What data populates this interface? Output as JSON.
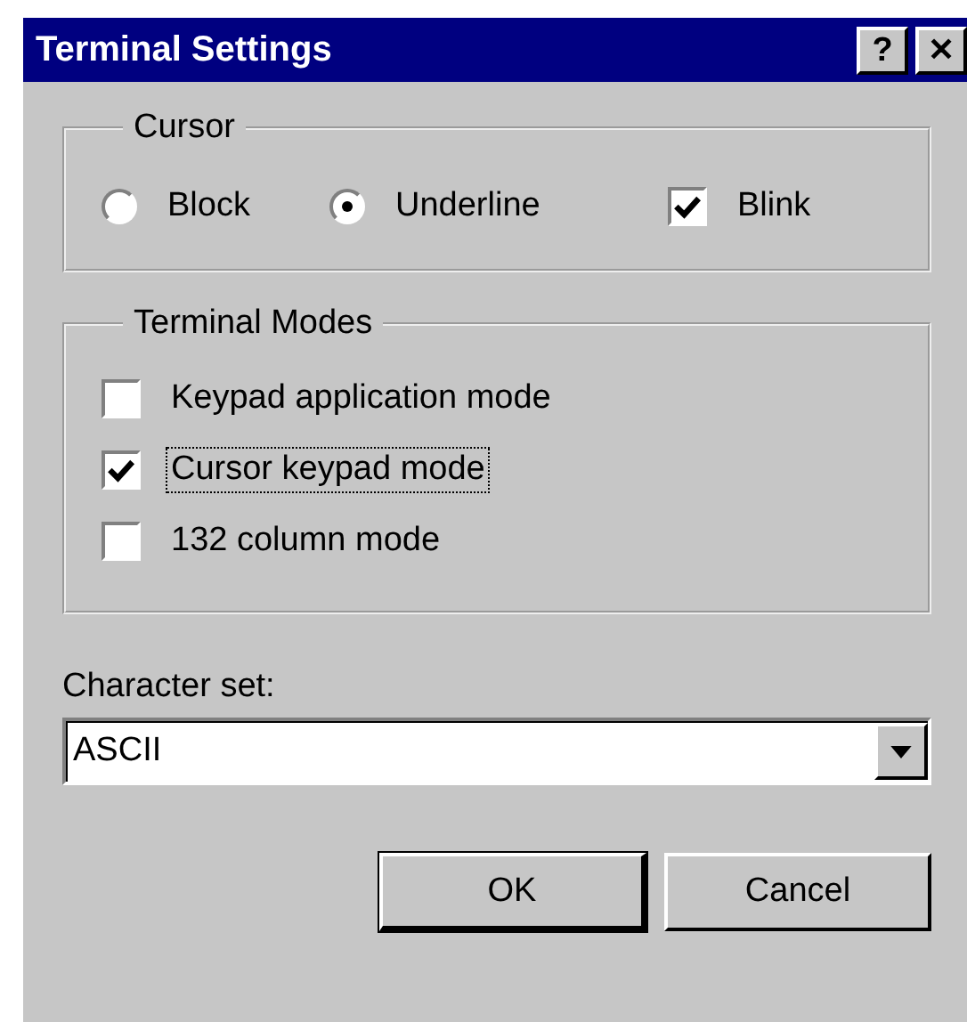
{
  "window": {
    "title": "Terminal Settings",
    "title_buttons": [
      {
        "kind": "help",
        "label": "?"
      },
      {
        "kind": "close",
        "label": "✕"
      }
    ]
  },
  "cursor_group": {
    "title": "Cursor",
    "options": [
      {
        "kind": "radio",
        "label": "Block",
        "selected": false,
        "focused": false
      },
      {
        "kind": "radio",
        "label": "Underline",
        "selected": true,
        "focused": false
      },
      {
        "kind": "checkbox",
        "label": "Blink",
        "checked": true,
        "focused": false
      }
    ]
  },
  "modes_group": {
    "title": "Terminal Modes",
    "options": [
      {
        "kind": "checkbox",
        "label": "Keypad application mode",
        "checked": false,
        "focused": false
      },
      {
        "kind": "checkbox",
        "label": "Cursor keypad mode",
        "checked": true,
        "focused": true
      },
      {
        "kind": "checkbox",
        "label": "132 column mode",
        "checked": false,
        "focused": false
      }
    ]
  },
  "character_set": {
    "label": "Character set:",
    "value": "ASCII"
  },
  "buttons": [
    {
      "label": "OK",
      "default": true
    },
    {
      "label": "Cancel",
      "default": false
    }
  ]
}
